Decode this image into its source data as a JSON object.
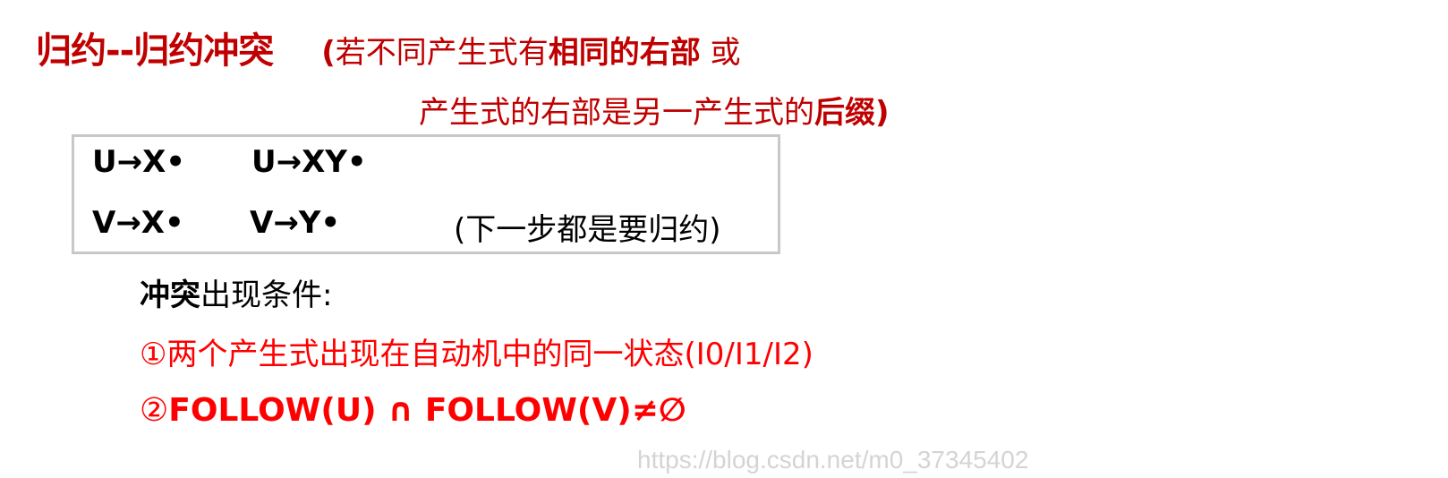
{
  "title": {
    "main": "归约--归约冲突",
    "paren_open": "(",
    "desc_part1": "若不同产生式有",
    "desc_bold": "相同的右部",
    "desc_part2": " 或"
  },
  "subtitle": {
    "text": "产生式的右部是另一产生式的",
    "bold": "后缀",
    "paren_close": ")"
  },
  "example_box": {
    "row1": {
      "prod1": "U→X•",
      "prod2": "U→XY•"
    },
    "row2": {
      "prod1": "V→X•",
      "prod2": "V→Y•",
      "note": "(下一步都是要归约)"
    }
  },
  "conditions": {
    "heading_bold": "冲突",
    "heading_rest": "出现条件:",
    "item1": "①两个产生式出现在自动机中的同一状态(I0/I1/I2)",
    "item2_num": "②",
    "item2_expr": "FOLLOW(U) ∩ FOLLOW(V)≠∅"
  },
  "watermark": "https://blog.csdn.net/m0_37345402",
  "colors": {
    "title_red": "#c00000",
    "condition_red": "#ff0000",
    "box_border": "#c8c8c8",
    "watermark": "#d4d4d4"
  }
}
